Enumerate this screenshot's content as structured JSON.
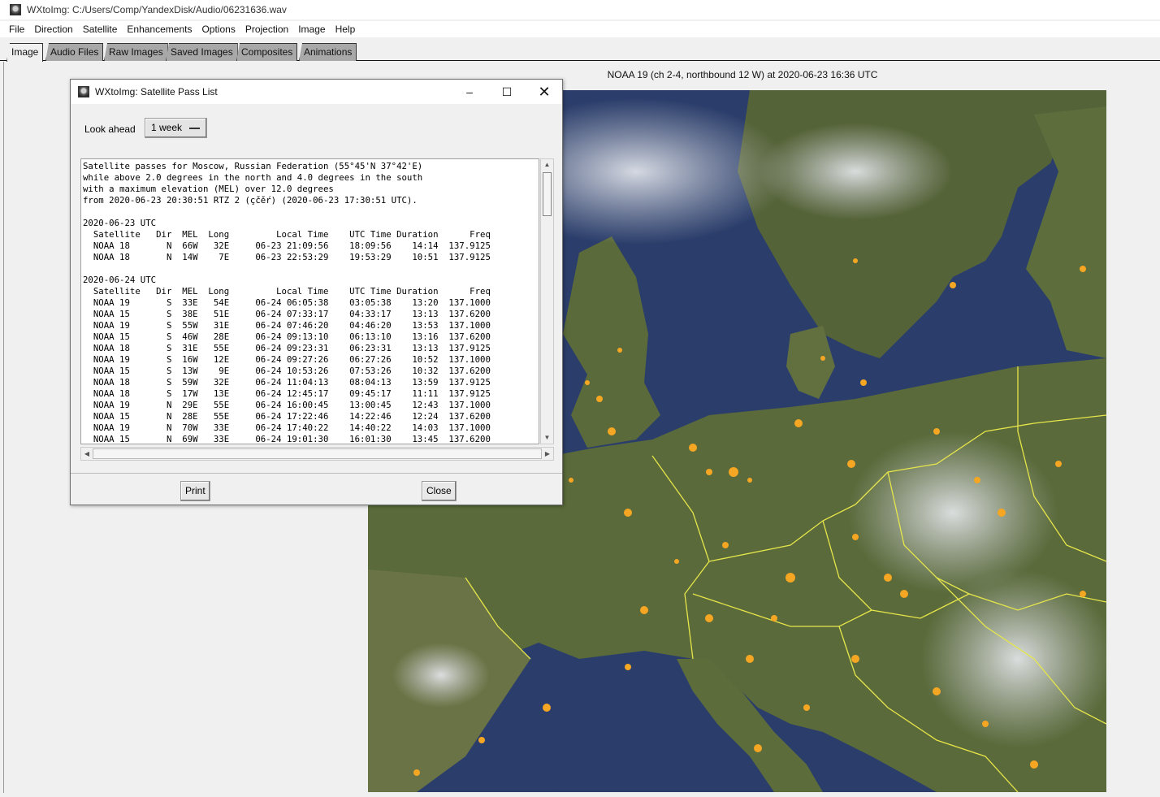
{
  "window": {
    "title": "WXtoImg: C:/Users/Comp/YandexDisk/Audio/06231636.wav"
  },
  "menu": [
    "File",
    "Direction",
    "Satellite",
    "Enhancements",
    "Options",
    "Projection",
    "Image",
    "Help"
  ],
  "tabs": [
    {
      "label": "Image",
      "active": true
    },
    {
      "label": "Audio Files",
      "active": false
    },
    {
      "label": "Raw Images",
      "active": false
    },
    {
      "label": "Saved Images",
      "active": false
    },
    {
      "label": "Composites",
      "active": false
    },
    {
      "label": "Animations",
      "active": false
    }
  ],
  "image": {
    "caption": "NOAA 19 (ch 2-4, northbound 12 W) at 2020-06-23  16:36 UTC"
  },
  "dialog": {
    "title": "WXtoImg: Satellite Pass List",
    "look_ahead_label": "Look ahead",
    "look_ahead_value": "1 week",
    "passes_text": "Satellite passes for Moscow, Russian Federation (55°45'N 37°42'E)\nwhile above 2.0 degrees in the north and 4.0 degrees in the south\nwith a maximum elevation (MEL) over 12.0 degrees\nfrom 2020-06-23 20:30:51 RTZ 2 (çčěŕ) (2020-06-23 17:30:51 UTC).\n\n2020-06-23 UTC\n  Satellite   Dir  MEL  Long         Local Time    UTC Time Duration      Freq\n  NOAA 18       N  66W   32E     06-23 21:09:56    18:09:56    14:14  137.9125\n  NOAA 18       N  14W    7E     06-23 22:53:29    19:53:29    10:51  137.9125\n\n2020-06-24 UTC\n  Satellite   Dir  MEL  Long         Local Time    UTC Time Duration      Freq\n  NOAA 19       S  33E   54E     06-24 06:05:38    03:05:38    13:20  137.1000\n  NOAA 15       S  38E   51E     06-24 07:33:17    04:33:17    13:13  137.6200\n  NOAA 19       S  55W   31E     06-24 07:46:20    04:46:20    13:53  137.1000\n  NOAA 15       S  46W   28E     06-24 09:13:10    06:13:10    13:16  137.6200\n  NOAA 18       S  31E   55E     06-24 09:23:31    06:23:31    13:13  137.9125\n  NOAA 19       S  16W   12E     06-24 09:27:26    06:27:26    10:52  137.1000\n  NOAA 15       S  13W    9E     06-24 10:53:26    07:53:26    10:32  137.6200\n  NOAA 18       S  59W   32E     06-24 11:04:13    08:04:13    13:59  137.9125\n  NOAA 18       S  17W   13E     06-24 12:45:17    09:45:17    11:11  137.9125\n  NOAA 19       N  29E   55E     06-24 16:00:45    13:00:45    12:43  137.1000\n  NOAA 15       N  28E   55E     06-24 17:22:46    14:22:46    12:24  137.6200\n  NOAA 19       N  70W   33E     06-24 17:40:22    14:40:22    14:03  137.1000\n  NOAA 15       N  69W   33E     06-24 19:01:30    16:01:30    13:45  137.6200",
    "print_label": "Print",
    "close_label": "Close"
  },
  "colors": {
    "sea": "#2b3e6b",
    "land": "#5a6a3c",
    "borders": "#e6e64a",
    "cities": "#f5a623"
  }
}
